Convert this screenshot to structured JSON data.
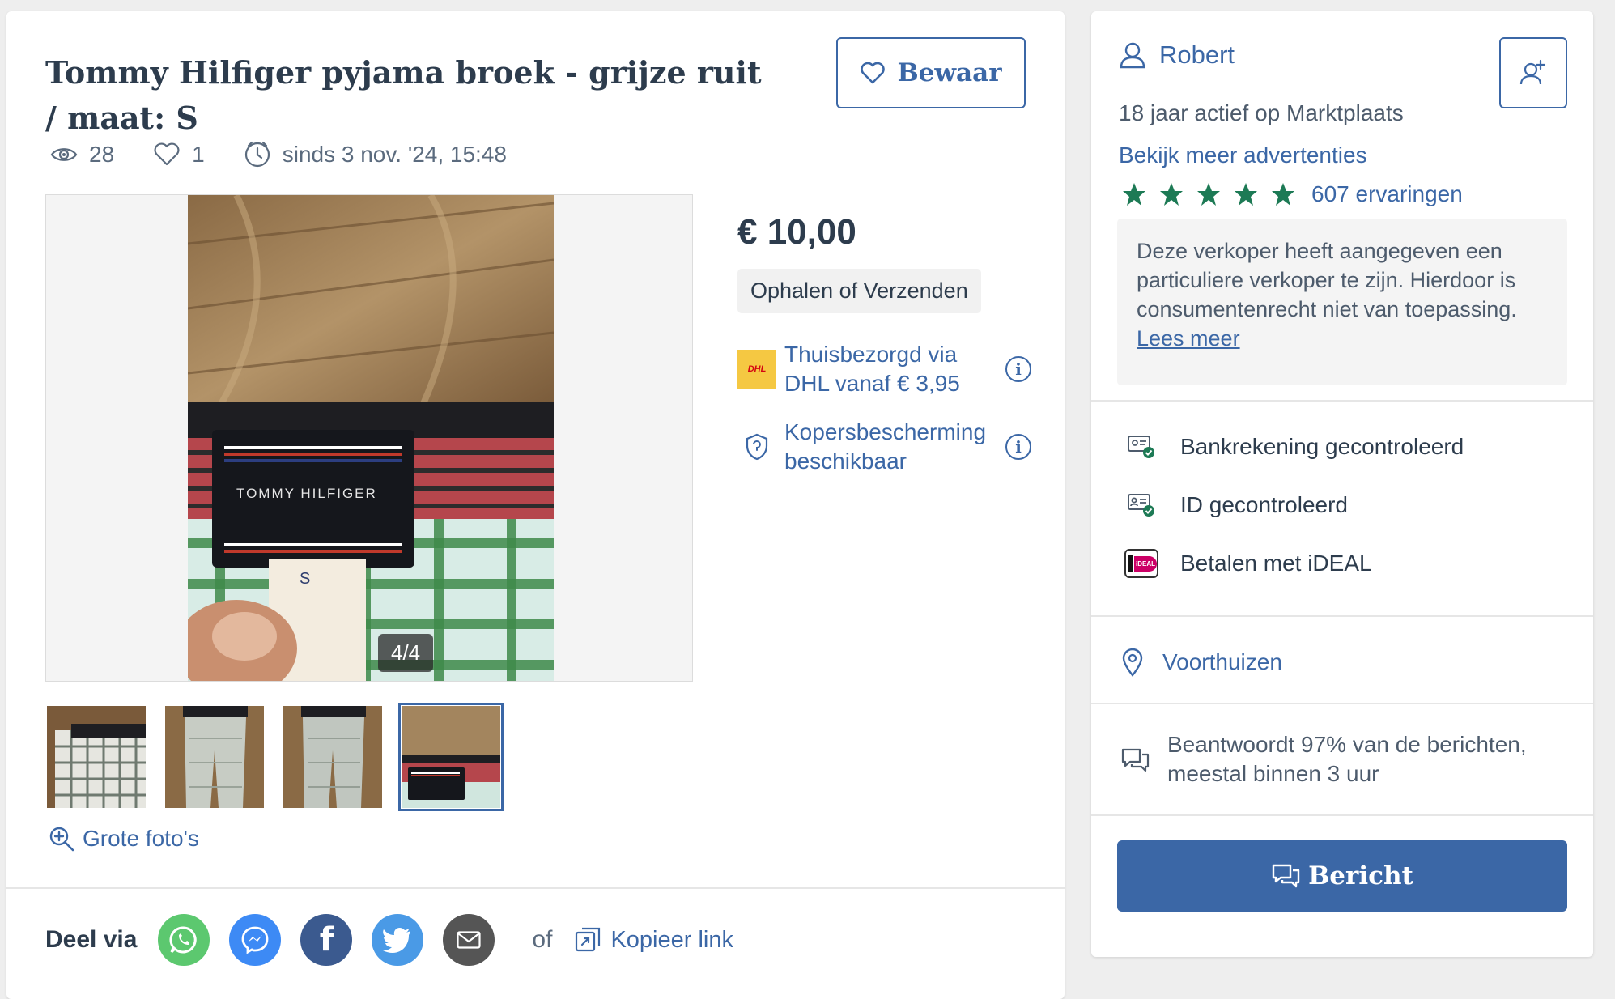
{
  "listing": {
    "title": "Tommy Hilfiger pyjama broek - grijze ruit / maat: S",
    "save_label": "Bewaar",
    "views": "28",
    "favorites": "1",
    "posted": "sinds 3 nov. '24, 15:48",
    "photo_counter": "4/4",
    "photo_label_brand": "TOMMY HILFIGER",
    "photo_label_size": "S",
    "big_photos_label": "Grote foto's",
    "price": "€ 10,00",
    "delivery": "Ophalen of Verzenden",
    "shipping_text": "Thuisbezorgd via DHL vanaf € 3,95",
    "dhl_logo": "DHL",
    "protection_text": "Kopersbescherming beschikbaar"
  },
  "share": {
    "label": "Deel via",
    "or": "of",
    "copy_link": "Kopieer link",
    "channels": [
      "whatsapp",
      "messenger",
      "facebook",
      "twitter",
      "email"
    ]
  },
  "seller": {
    "name": "Robert",
    "active_since": "18 jaar actief op Marktplaats",
    "more_ads": "Bekijk meer advertenties",
    "star_count": 5,
    "reviews": "607 ervaringen",
    "notice": "Deze verkoper heeft aangegeven een particuliere verkoper te zijn. Hierdoor is consumentenrecht niet van toepassing.",
    "read_more": "Lees meer",
    "checks": {
      "bank": "Bankrekening gecontroleerd",
      "id": "ID gecontroleerd",
      "ideal": "Betalen met iDEAL",
      "ideal_logo": "iDEAL"
    },
    "location": "Voorthuizen",
    "response": "Beantwoordt 97% van de berichten, meestal binnen 3 uur",
    "message_label": "Bericht"
  },
  "colors": {
    "accent": "#3b67a6",
    "text": "#2d3c4d",
    "star": "#1d7a55",
    "whatsapp": "#5cc86f",
    "messenger": "#3d8af5",
    "facebook": "#3b5a8f",
    "twitter": "#4a9ae6",
    "email": "#555555"
  }
}
